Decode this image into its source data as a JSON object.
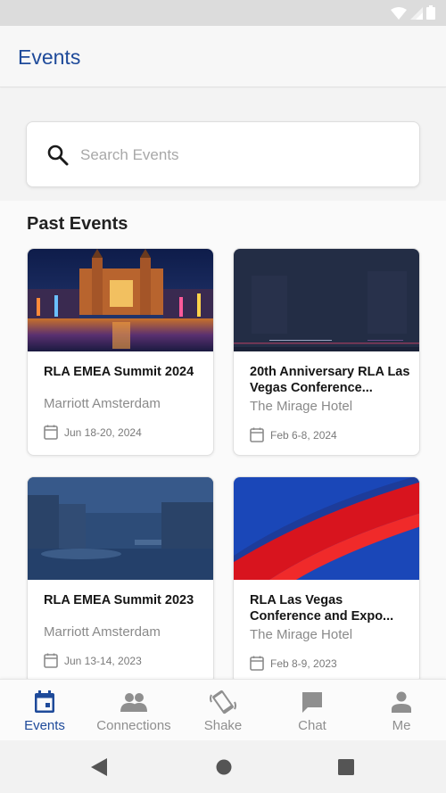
{
  "app": {
    "title": "Events"
  },
  "search": {
    "placeholder": "Search Events",
    "icon": "search-icon"
  },
  "section": {
    "title": "Past Events"
  },
  "events": [
    {
      "title": "RLA EMEA Summit 2024",
      "venue": "Marriott Amsterdam",
      "date": "Jun 18-20, 2024"
    },
    {
      "title": "20th Anniversary RLA Las Vegas Conference...",
      "venue": "The Mirage Hotel",
      "date": "Feb 6-8, 2024"
    },
    {
      "title": "RLA EMEA Summit 2023",
      "venue": "Marriott Amsterdam",
      "date": "Jun 13-14, 2023"
    },
    {
      "title": "RLA Las Vegas Conference and Expo...",
      "venue": "The Mirage Hotel",
      "date": "Feb 8-9, 2023"
    }
  ],
  "nav": {
    "items": [
      {
        "label": "Events",
        "icon": "calendar-icon",
        "active": true
      },
      {
        "label": "Connections",
        "icon": "people-icon",
        "active": false
      },
      {
        "label": "Shake",
        "icon": "shake-phone-icon",
        "active": false
      },
      {
        "label": "Chat",
        "icon": "chat-bubble-icon",
        "active": false
      },
      {
        "label": "Me",
        "icon": "person-icon",
        "active": false
      }
    ]
  },
  "colors": {
    "accent": "#1e4a9a",
    "inactive": "#8f8f8f"
  }
}
